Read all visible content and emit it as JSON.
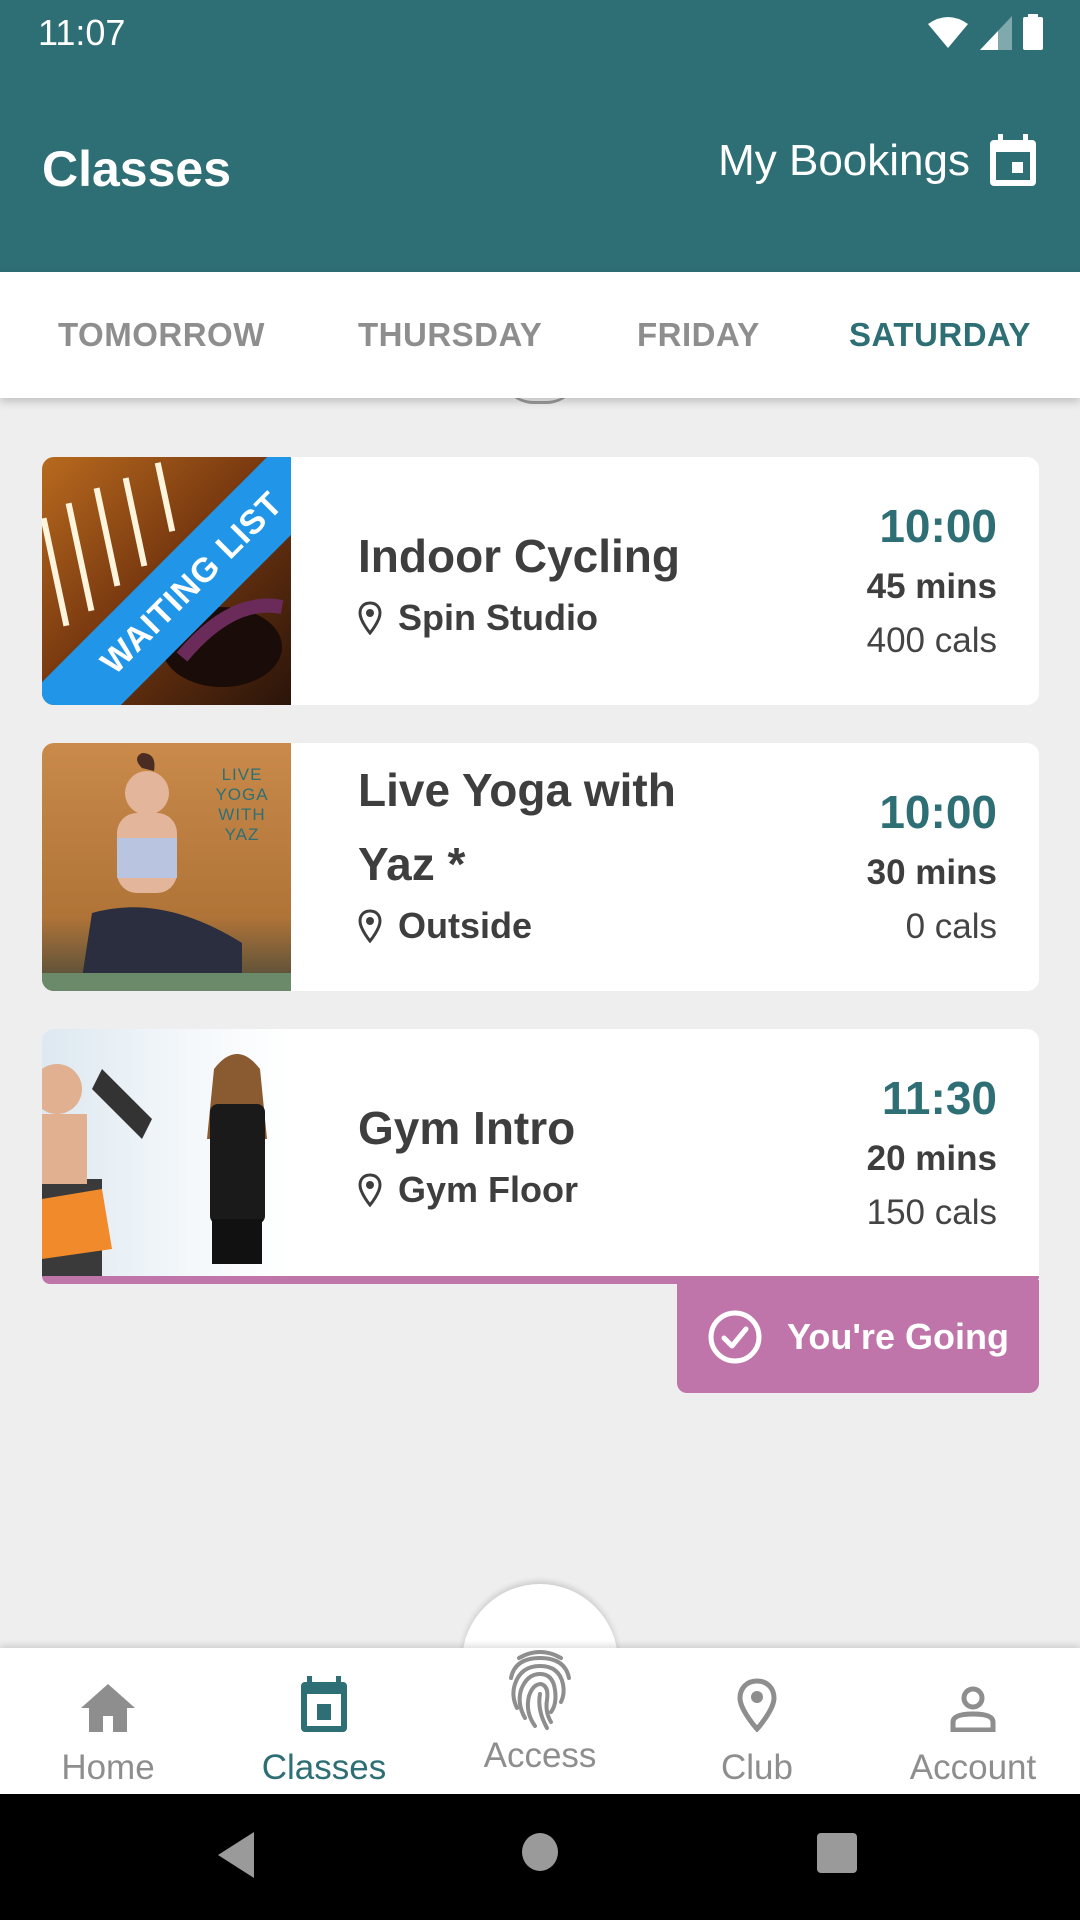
{
  "status_bar": {
    "time": "11:07"
  },
  "app_bar": {
    "title": "Classes",
    "my_bookings_label": "My Bookings"
  },
  "tabs": [
    {
      "label": "TOMORROW",
      "active": false
    },
    {
      "label": "THURSDAY",
      "active": false
    },
    {
      "label": "FRIDAY",
      "active": false
    },
    {
      "label": "SATURDAY",
      "active": true
    }
  ],
  "classes": [
    {
      "title": "Indoor Cycling",
      "location": "Spin Studio",
      "time": "10:00",
      "duration": "45 mins",
      "calories": "400 cals",
      "badge": "WAITING LIST"
    },
    {
      "title_line1": "Live Yoga with",
      "title_line2": "Yaz *",
      "location": "Outside",
      "time": "10:00",
      "duration": "30 mins",
      "calories": "0 cals",
      "image_text": "LIVE YOGA WITH YAZ"
    },
    {
      "title": "Gym Intro",
      "location": "Gym Floor",
      "time": "11:30",
      "duration": "20 mins",
      "calories": "150 cals",
      "status_button": "You're Going"
    }
  ],
  "bottom_nav": [
    {
      "label": "Home",
      "icon": "home-icon",
      "active": false
    },
    {
      "label": "Classes",
      "icon": "calendar-icon",
      "active": true
    },
    {
      "label": "Access",
      "icon": "fingerprint-icon",
      "active": false
    },
    {
      "label": "Club",
      "icon": "location-pin-icon",
      "active": false
    },
    {
      "label": "Account",
      "icon": "person-icon",
      "active": false
    }
  ],
  "colors": {
    "primary": "#2e6f75",
    "waiting_list": "#2196e8",
    "going": "#c075aa",
    "inactive": "#8e8e8e"
  }
}
